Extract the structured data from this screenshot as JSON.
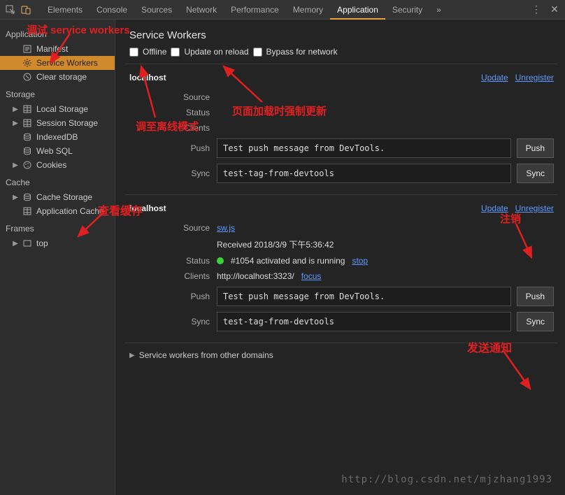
{
  "tabs": {
    "items": [
      "Elements",
      "Console",
      "Sources",
      "Network",
      "Performance",
      "Memory",
      "Application",
      "Security"
    ],
    "active": "Application",
    "more_icon": "»"
  },
  "sidebar": {
    "groups": [
      {
        "title": "Application",
        "items": [
          {
            "icon": "manifest",
            "label": "Manifest"
          },
          {
            "icon": "gear",
            "label": "Service Workers",
            "selected": true
          },
          {
            "icon": "clear",
            "label": "Clear storage"
          }
        ]
      },
      {
        "title": "Storage",
        "items": [
          {
            "arrow": "▶",
            "icon": "grid",
            "label": "Local Storage"
          },
          {
            "arrow": "▶",
            "icon": "grid",
            "label": "Session Storage"
          },
          {
            "icon": "db",
            "label": "IndexedDB"
          },
          {
            "icon": "db",
            "label": "Web SQL"
          },
          {
            "arrow": "▶",
            "icon": "cookie",
            "label": "Cookies"
          }
        ]
      },
      {
        "title": "Cache",
        "items": [
          {
            "arrow": "▶",
            "icon": "db",
            "label": "Cache Storage"
          },
          {
            "icon": "grid",
            "label": "Application Cache"
          }
        ]
      },
      {
        "title": "Frames",
        "items": [
          {
            "arrow": "▶",
            "icon": "frame",
            "label": "top"
          }
        ]
      }
    ]
  },
  "panel": {
    "title": "Service Workers",
    "checks": {
      "offline": "Offline",
      "update_on_reload": "Update on reload",
      "bypass": "Bypass for network"
    },
    "labels": {
      "source": "Source",
      "status": "Status",
      "clients": "Clients",
      "push": "Push",
      "sync": "Sync"
    },
    "links": {
      "update": "Update",
      "unregister": "Unregister",
      "stop": "stop",
      "focus": "focus"
    },
    "buttons": {
      "push": "Push",
      "sync": "Sync"
    },
    "workers": [
      {
        "host": "localhost",
        "push_value": "Test push message from DevTools.",
        "sync_value": "test-tag-from-devtools"
      },
      {
        "host": "localhost",
        "source_file": "sw.js",
        "received": "Received 2018/3/9 下午5:36:42",
        "status_text": "#1054 activated and is running",
        "client_url": "http://localhost:3323/",
        "push_value": "Test push message from DevTools.",
        "sync_value": "test-tag-from-devtools"
      }
    ],
    "other_domains": "Service workers from other domains"
  },
  "annotations": {
    "debug_sw": "调试 service workers",
    "offline_mode": "调至离线模式",
    "force_update": "页面加载时强制更新",
    "view_cache": "查看缓存",
    "unregister": "注销",
    "send_notify": "发送通知"
  },
  "watermark": "http://blog.csdn.net/mjzhang1993"
}
